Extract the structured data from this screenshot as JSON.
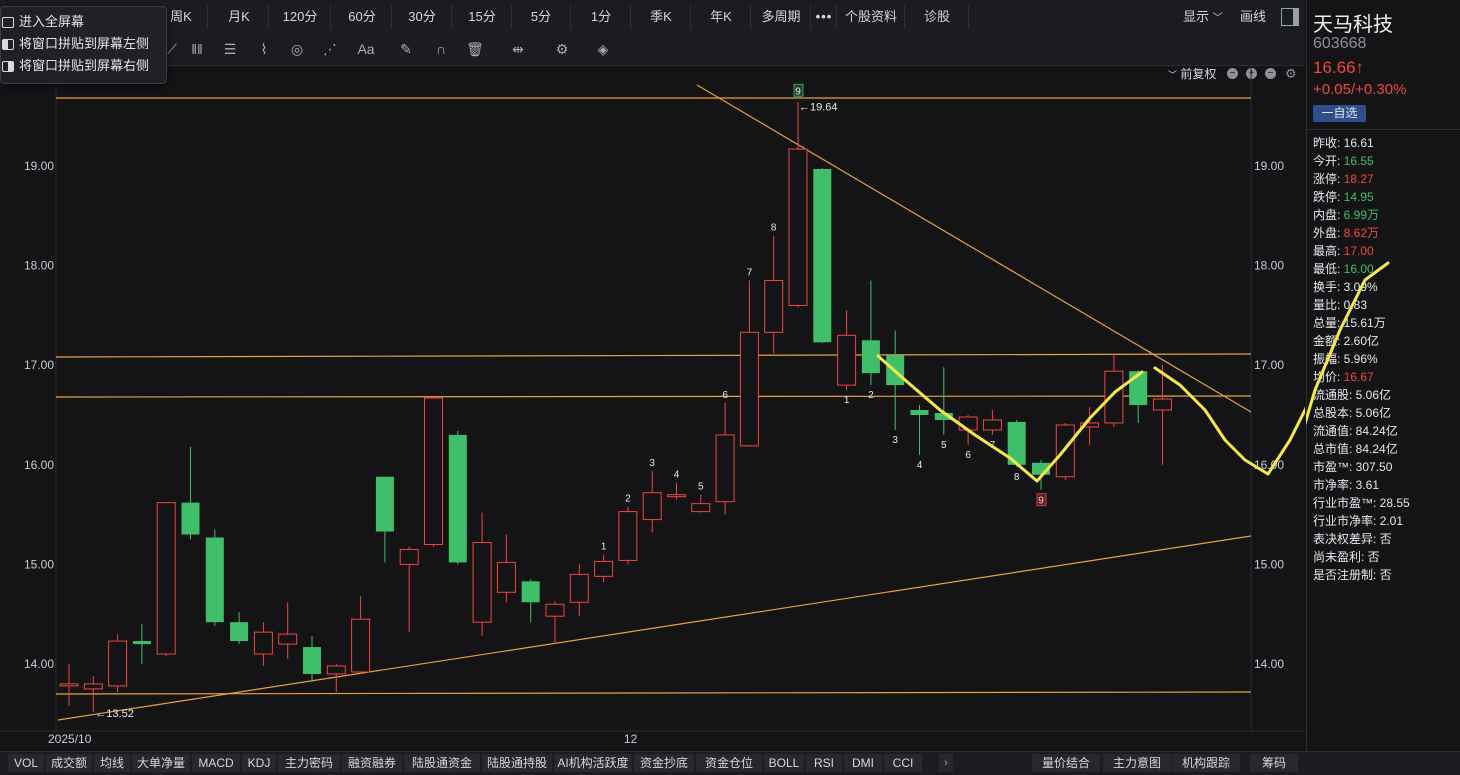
{
  "periods": [
    "周K",
    "月K",
    "120分",
    "60分",
    "30分",
    "15分",
    "5分",
    "1分",
    "季K",
    "年K",
    "多周期",
    "•••",
    "个股资料",
    "诊股"
  ],
  "topright": {
    "display": "显示",
    "draw": "画线"
  },
  "context_menu": [
    "进入全屏幕",
    "将窗口拼贴到屏幕左侧",
    "将窗口拼贴到屏幕右侧"
  ],
  "adjust_label": "前复权",
  "stock": {
    "name": "天马科技",
    "code": "603668",
    "price": "16.66↑",
    "change": "+0.05/+0.30%",
    "watch_button": "一自选"
  },
  "stats": [
    {
      "k": "昨收:",
      "v": "16.61",
      "c": "#e6e8ec"
    },
    {
      "k": "今开:",
      "v": "16.55",
      "c": "#3fbf6a"
    },
    {
      "k": "涨停:",
      "v": "18.27",
      "c": "#f0463f"
    },
    {
      "k": "跌停:",
      "v": "14.95",
      "c": "#3fbf6a"
    },
    {
      "k": "内盘:",
      "v": "6.99万",
      "c": "#3fbf6a"
    },
    {
      "k": "外盘:",
      "v": "8.62万",
      "c": "#f0463f"
    },
    {
      "k": "最高:",
      "v": "17.00",
      "c": "#f0463f"
    },
    {
      "k": "最低:",
      "v": "16.00",
      "c": "#3fbf6a"
    },
    {
      "k": "换手:",
      "v": "3.09%",
      "c": "#e6e8ec"
    },
    {
      "k": "量比:",
      "v": "0.83",
      "c": "#e6e8ec"
    },
    {
      "k": "总量:",
      "v": "15.61万",
      "c": "#e6e8ec"
    },
    {
      "k": "金额:",
      "v": "2.60亿",
      "c": "#e6e8ec"
    },
    {
      "k": "振幅:",
      "v": "5.96%",
      "c": "#e6e8ec"
    },
    {
      "k": "均价:",
      "v": "16.67",
      "c": "#f0463f"
    },
    {
      "k": "流通股:",
      "v": "5.06亿",
      "c": "#e6e8ec"
    },
    {
      "k": "总股本:",
      "v": "5.06亿",
      "c": "#e6e8ec"
    },
    {
      "k": "流通值:",
      "v": "84.24亿",
      "c": "#e6e8ec"
    },
    {
      "k": "总市值:",
      "v": "84.24亿",
      "c": "#e6e8ec"
    },
    {
      "k": "市盈™:",
      "v": "307.50",
      "c": "#e6e8ec"
    },
    {
      "k": "市净率:",
      "v": "3.61",
      "c": "#e6e8ec"
    },
    {
      "k": "行业市盈™:",
      "v": "28.55",
      "c": "#e6e8ec"
    },
    {
      "k": "行业市净率:",
      "v": "2.01",
      "c": "#e6e8ec"
    },
    {
      "k": "表决权差异:",
      "v": "否",
      "c": "#e6e8ec"
    },
    {
      "k": "尚未盈利:",
      "v": "否",
      "c": "#e6e8ec"
    },
    {
      "k": "是否注册制:",
      "v": "否",
      "c": "#e6e8ec"
    }
  ],
  "bottom_tabs": [
    "VOL",
    "成交额",
    "均线",
    "大单净量",
    "MACD",
    "KDJ",
    "主力密码",
    "融资融券",
    "陆股通资金",
    "陆股通持股",
    "AI机构活跃度",
    "资金抄底",
    "资金仓位",
    "BOLL",
    "RSI",
    "DMI",
    "CCI"
  ],
  "bottom_right_tabs": [
    "量价结合",
    "主力意图",
    "机构跟踪",
    "筹码"
  ],
  "colors": {
    "up": "#f0463f",
    "down": "#3fbf6a",
    "line": "#e8a23a",
    "yellow": "#f5e94a",
    "bg": "#141416"
  },
  "chart_data": {
    "type": "candlestick",
    "yticks": [
      "19.00",
      "18.00",
      "17.00",
      "16.00",
      "15.00",
      "14.00"
    ],
    "ylim": [
      13.3,
      19.8
    ],
    "xlabels": [
      {
        "i": 0,
        "t": "2025/10"
      },
      {
        "i": 23,
        "t": "12"
      }
    ],
    "high_label": "←19.64",
    "low_label": "←13.52",
    "candles": [
      {
        "o": 13.78,
        "h": 14.0,
        "l": 13.58,
        "c": 13.8,
        "n": ""
      },
      {
        "o": 13.75,
        "h": 13.88,
        "l": 13.52,
        "c": 13.8,
        "n": ""
      },
      {
        "o": 13.78,
        "h": 14.3,
        "l": 13.72,
        "c": 14.23,
        "n": ""
      },
      {
        "o": 14.23,
        "h": 14.4,
        "l": 14.0,
        "c": 14.2,
        "n": ""
      },
      {
        "o": 14.1,
        "h": 15.62,
        "l": 14.08,
        "c": 15.62,
        "n": ""
      },
      {
        "o": 15.62,
        "h": 16.18,
        "l": 15.25,
        "c": 15.3,
        "n": ""
      },
      {
        "o": 15.27,
        "h": 15.35,
        "l": 14.38,
        "c": 14.42,
        "n": ""
      },
      {
        "o": 14.42,
        "h": 14.52,
        "l": 14.2,
        "c": 14.23,
        "n": ""
      },
      {
        "o": 14.1,
        "h": 14.42,
        "l": 13.98,
        "c": 14.32,
        "n": ""
      },
      {
        "o": 14.2,
        "h": 14.62,
        "l": 14.05,
        "c": 14.3,
        "n": ""
      },
      {
        "o": 14.17,
        "h": 14.28,
        "l": 13.82,
        "c": 13.9,
        "n": ""
      },
      {
        "o": 13.9,
        "h": 14.0,
        "l": 13.72,
        "c": 13.98,
        "n": ""
      },
      {
        "o": 13.92,
        "h": 14.68,
        "l": 13.9,
        "c": 14.45,
        "n": ""
      },
      {
        "o": 15.88,
        "h": 15.88,
        "l": 15.02,
        "c": 15.33,
        "n": ""
      },
      {
        "o": 15.0,
        "h": 15.18,
        "l": 14.32,
        "c": 15.15,
        "n": ""
      },
      {
        "o": 15.2,
        "h": 16.68,
        "l": 15.18,
        "c": 16.67,
        "n": ""
      },
      {
        "o": 16.3,
        "h": 16.34,
        "l": 15.0,
        "c": 15.02,
        "n": ""
      },
      {
        "o": 14.42,
        "h": 15.52,
        "l": 14.28,
        "c": 15.22,
        "n": ""
      },
      {
        "o": 14.72,
        "h": 15.3,
        "l": 14.62,
        "c": 15.02,
        "n": ""
      },
      {
        "o": 14.83,
        "h": 14.85,
        "l": 14.42,
        "c": 14.62,
        "n": ""
      },
      {
        "o": 14.48,
        "h": 14.63,
        "l": 14.2,
        "c": 14.6,
        "n": ""
      },
      {
        "o": 14.62,
        "h": 15.0,
        "l": 14.48,
        "c": 14.9,
        "n": ""
      },
      {
        "o": 14.88,
        "h": 15.1,
        "l": 14.82,
        "c": 15.03,
        "n": "1"
      },
      {
        "o": 15.04,
        "h": 15.58,
        "l": 15.0,
        "c": 15.53,
        "n": "2"
      },
      {
        "o": 15.45,
        "h": 15.94,
        "l": 15.32,
        "c": 15.72,
        "n": "3"
      },
      {
        "o": 15.68,
        "h": 15.82,
        "l": 15.65,
        "c": 15.7,
        "n": "4"
      },
      {
        "o": 15.53,
        "h": 15.7,
        "l": 15.52,
        "c": 15.61,
        "n": "5"
      },
      {
        "o": 15.63,
        "h": 16.62,
        "l": 15.5,
        "c": 16.3,
        "n": "6"
      },
      {
        "o": 16.19,
        "h": 17.85,
        "l": 16.18,
        "c": 17.33,
        "n": "7"
      },
      {
        "o": 17.33,
        "h": 18.3,
        "l": 17.12,
        "c": 17.85,
        "n": "8"
      },
      {
        "o": 17.6,
        "h": 19.64,
        "l": 17.58,
        "c": 19.17,
        "n": "9"
      },
      {
        "o": 18.97,
        "h": 18.98,
        "l": 17.22,
        "c": 17.23,
        "n": ""
      },
      {
        "o": 16.8,
        "h": 17.55,
        "l": 16.75,
        "c": 17.3,
        "n": "1"
      },
      {
        "o": 17.25,
        "h": 17.85,
        "l": 16.8,
        "c": 16.92,
        "n": "2"
      },
      {
        "o": 17.1,
        "h": 17.35,
        "l": 16.35,
        "c": 16.8,
        "n": "3"
      },
      {
        "o": 16.55,
        "h": 16.6,
        "l": 16.1,
        "c": 16.5,
        "n": "4"
      },
      {
        "o": 16.52,
        "h": 16.98,
        "l": 16.3,
        "c": 16.45,
        "n": "5"
      },
      {
        "o": 16.35,
        "h": 16.5,
        "l": 16.2,
        "c": 16.48,
        "n": "6"
      },
      {
        "o": 16.35,
        "h": 16.55,
        "l": 16.3,
        "c": 16.45,
        "n": "7"
      },
      {
        "o": 16.43,
        "h": 16.45,
        "l": 15.98,
        "c": 16.0,
        "n": "8"
      },
      {
        "o": 16.02,
        "h": 16.05,
        "l": 15.75,
        "c": 15.9,
        "n": "9"
      },
      {
        "o": 15.88,
        "h": 16.42,
        "l": 15.85,
        "c": 16.4,
        "n": ""
      },
      {
        "o": 16.38,
        "h": 16.58,
        "l": 16.2,
        "c": 16.42,
        "n": ""
      },
      {
        "o": 16.42,
        "h": 17.12,
        "l": 16.38,
        "c": 16.94,
        "n": ""
      },
      {
        "o": 16.94,
        "h": 16.95,
        "l": 16.42,
        "c": 16.6,
        "n": ""
      },
      {
        "o": 16.55,
        "h": 17.0,
        "l": 16.0,
        "c": 16.66,
        "n": ""
      }
    ]
  }
}
